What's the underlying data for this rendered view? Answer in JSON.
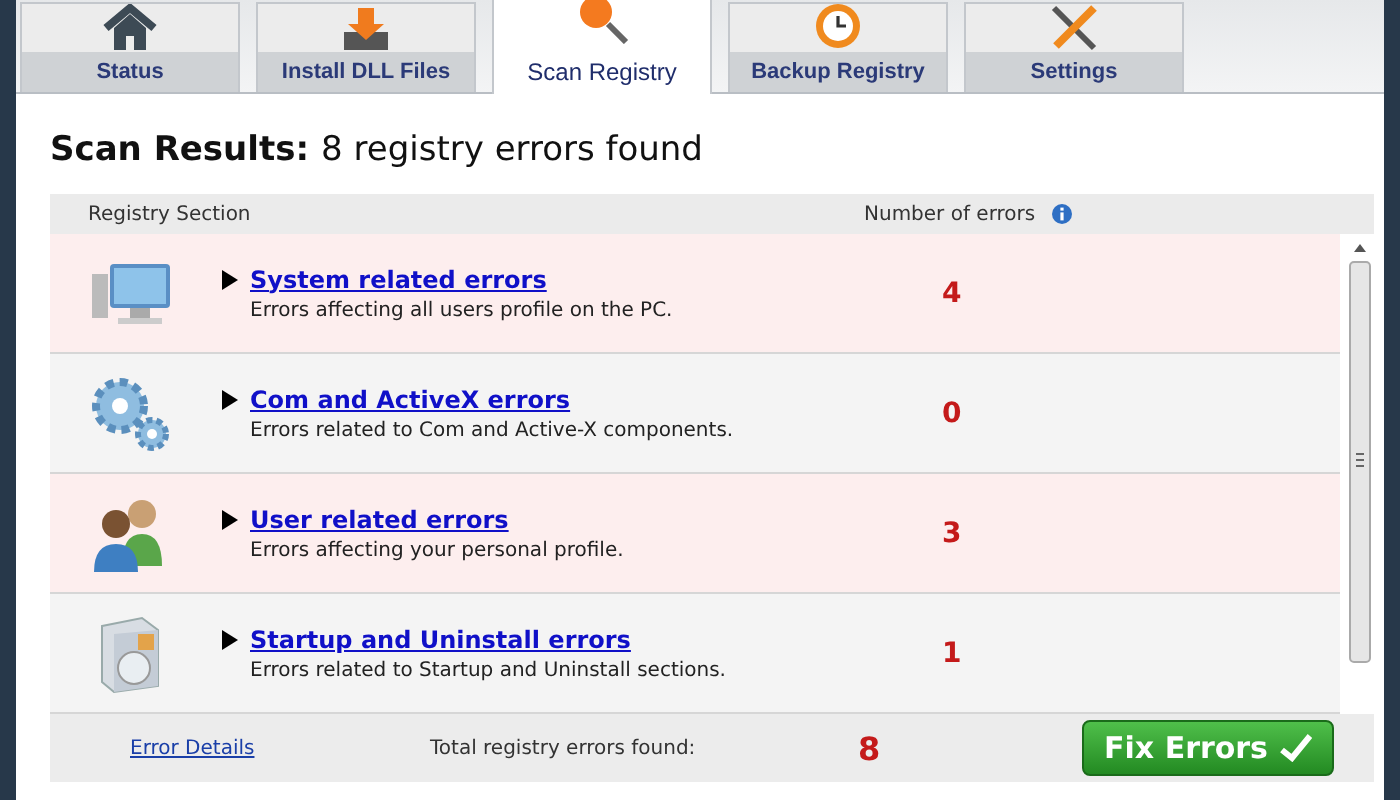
{
  "tabs": [
    {
      "label": "Status",
      "kind": "house",
      "selected": false
    },
    {
      "label": "Install DLL Files",
      "kind": "download",
      "selected": false
    },
    {
      "label": "Scan Registry",
      "kind": "magnifier",
      "selected": true
    },
    {
      "label": "Backup Registry",
      "kind": "clock",
      "selected": false
    },
    {
      "label": "Settings",
      "kind": "tools",
      "selected": false
    }
  ],
  "heading": {
    "label": "Scan Results:",
    "text": "8 registry errors found"
  },
  "table": {
    "columns": [
      "Registry Section",
      "Number of errors"
    ],
    "rows": [
      {
        "kind": "monitor",
        "title": "System related errors",
        "description": "Errors affecting all users profile on the PC.",
        "count": "4"
      },
      {
        "kind": "gears",
        "title": "Com and ActiveX errors",
        "description": "Errors related to Com and Active-X components.",
        "count": "0"
      },
      {
        "kind": "users",
        "title": "User related errors",
        "description": "Errors affecting your personal profile.",
        "count": "3"
      },
      {
        "kind": "box",
        "title": "Startup and Uninstall errors",
        "description": "Errors related to Startup and Uninstall sections.",
        "count": "1"
      }
    ]
  },
  "footer": {
    "link": "Error Details",
    "total_label": "Total registry errors found:",
    "total": "8",
    "button": "Fix Errors"
  }
}
